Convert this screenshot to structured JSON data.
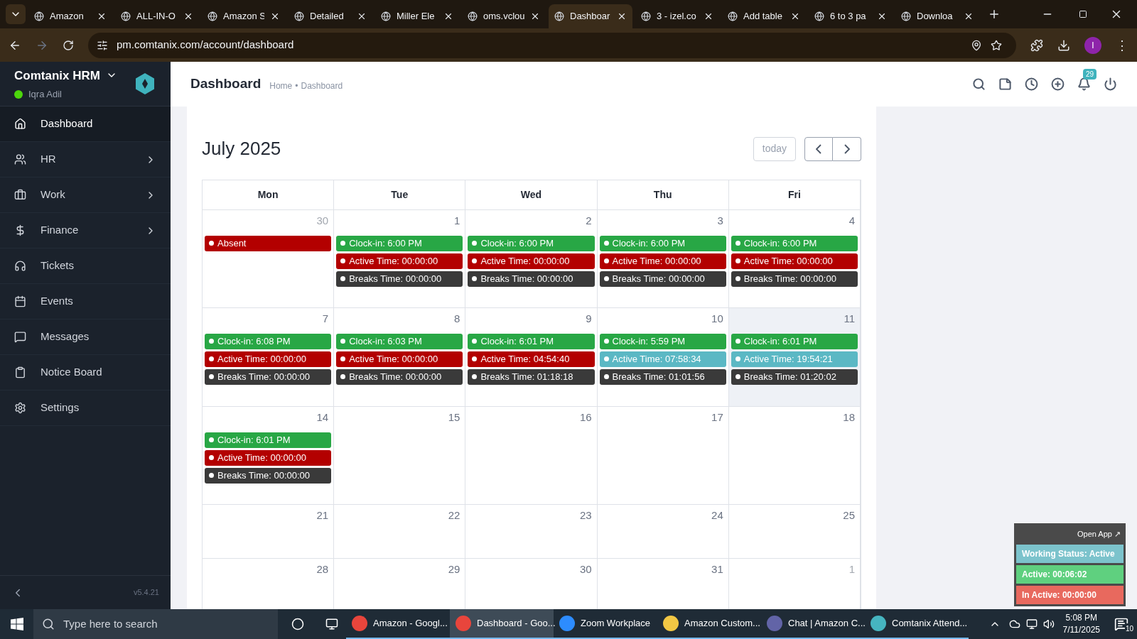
{
  "browser": {
    "tabs": [
      {
        "title": "Amazon",
        "selected": false
      },
      {
        "title": "ALL-IN-O",
        "selected": false
      },
      {
        "title": "Amazon S",
        "selected": false
      },
      {
        "title": "Detailed",
        "selected": false
      },
      {
        "title": "Miller Ele",
        "selected": false
      },
      {
        "title": "oms.vclou",
        "selected": false
      },
      {
        "title": "Dashboar",
        "selected": true
      },
      {
        "title": "3 - izel.co",
        "selected": false
      },
      {
        "title": "Add table",
        "selected": false
      },
      {
        "title": "6 to 3 pa",
        "selected": false
      },
      {
        "title": "Downloa",
        "selected": false
      }
    ],
    "url": "pm.comtanix.com/account/dashboard",
    "profile": "I",
    "menu": "⋮"
  },
  "sidebar": {
    "brand": "Comtanix HRM",
    "user": "Iqra Adil",
    "online": true,
    "items": [
      {
        "label": "Dashboard",
        "selected": true,
        "has_submenu": false
      },
      {
        "label": "HR",
        "selected": false,
        "has_submenu": true
      },
      {
        "label": "Work",
        "selected": false,
        "has_submenu": true
      },
      {
        "label": "Finance",
        "selected": false,
        "has_submenu": true
      },
      {
        "label": "Tickets",
        "selected": false,
        "has_submenu": false
      },
      {
        "label": "Events",
        "selected": false,
        "has_submenu": false
      },
      {
        "label": "Messages",
        "selected": false,
        "has_submenu": false
      },
      {
        "label": "Notice Board",
        "selected": false,
        "has_submenu": false
      },
      {
        "label": "Settings",
        "selected": false,
        "has_submenu": false
      }
    ],
    "version": "v5.4.21"
  },
  "header": {
    "title": "Dashboard",
    "breadcrumb": [
      "Home",
      "Dashboard"
    ],
    "breadcrumb_separator": "•",
    "notification_count": "29"
  },
  "calendar": {
    "title": "July 2025",
    "today_button": "today",
    "days": [
      "Mon",
      "Tue",
      "Wed",
      "Thu",
      "Fri"
    ],
    "weeks": [
      [
        {
          "date": "30",
          "other_month": true,
          "today": false,
          "events": [
            {
              "text": "Absent",
              "color": "#b30000"
            }
          ]
        },
        {
          "date": "1",
          "other_month": false,
          "today": false,
          "events": [
            {
              "text": "Clock-in: 6:00 PM",
              "color": "#28a745"
            },
            {
              "text": "Active Time: 00:00:00",
              "color": "#b30000"
            },
            {
              "text": "Breaks Time: 00:00:00",
              "color": "#3a3a3a"
            }
          ]
        },
        {
          "date": "2",
          "other_month": false,
          "today": false,
          "events": [
            {
              "text": "Clock-in: 6:00 PM",
              "color": "#28a745"
            },
            {
              "text": "Active Time: 00:00:00",
              "color": "#b30000"
            },
            {
              "text": "Breaks Time: 00:00:00",
              "color": "#3a3a3a"
            }
          ]
        },
        {
          "date": "3",
          "other_month": false,
          "today": false,
          "events": [
            {
              "text": "Clock-in: 6:00 PM",
              "color": "#28a745"
            },
            {
              "text": "Active Time: 00:00:00",
              "color": "#b30000"
            },
            {
              "text": "Breaks Time: 00:00:00",
              "color": "#3a3a3a"
            }
          ]
        },
        {
          "date": "4",
          "other_month": false,
          "today": false,
          "events": [
            {
              "text": "Clock-in: 6:00 PM",
              "color": "#28a745"
            },
            {
              "text": "Active Time: 00:00:00",
              "color": "#b30000"
            },
            {
              "text": "Breaks Time: 00:00:00",
              "color": "#3a3a3a"
            }
          ]
        }
      ],
      [
        {
          "date": "7",
          "other_month": false,
          "today": false,
          "events": [
            {
              "text": "Clock-in: 6:08 PM",
              "color": "#28a745"
            },
            {
              "text": "Active Time: 00:00:00",
              "color": "#b30000"
            },
            {
              "text": "Breaks Time: 00:00:00",
              "color": "#3a3a3a"
            }
          ]
        },
        {
          "date": "8",
          "other_month": false,
          "today": false,
          "events": [
            {
              "text": "Clock-in: 6:03 PM",
              "color": "#28a745"
            },
            {
              "text": "Active Time: 00:00:00",
              "color": "#b30000"
            },
            {
              "text": "Breaks Time: 00:00:00",
              "color": "#3a3a3a"
            }
          ]
        },
        {
          "date": "9",
          "other_month": false,
          "today": false,
          "events": [
            {
              "text": "Clock-in: 6:01 PM",
              "color": "#28a745"
            },
            {
              "text": "Active Time: 04:54:40",
              "color": "#b30000"
            },
            {
              "text": "Breaks Time: 01:18:18",
              "color": "#3a3a3a"
            }
          ]
        },
        {
          "date": "10",
          "other_month": false,
          "today": false,
          "events": [
            {
              "text": "Clock-in: 5:59 PM",
              "color": "#28a745"
            },
            {
              "text": "Active Time: 07:58:34",
              "color": "#5bb8c4"
            },
            {
              "text": "Breaks Time: 01:01:56",
              "color": "#3a3a3a"
            }
          ]
        },
        {
          "date": "11",
          "other_month": false,
          "today": true,
          "events": [
            {
              "text": "Clock-in: 6:01 PM",
              "color": "#28a745"
            },
            {
              "text": "Active Time: 19:54:21",
              "color": "#5bb8c4"
            },
            {
              "text": "Breaks Time: 01:20:02",
              "color": "#3a3a3a"
            }
          ]
        }
      ],
      [
        {
          "date": "14",
          "other_month": false,
          "today": false,
          "events": [
            {
              "text": "Clock-in: 6:01 PM",
              "color": "#28a745"
            },
            {
              "text": "Active Time: 00:00:00",
              "color": "#b30000"
            },
            {
              "text": "Breaks Time: 00:00:00",
              "color": "#3a3a3a"
            }
          ]
        },
        {
          "date": "15",
          "other_month": false,
          "today": false
        },
        {
          "date": "16",
          "other_month": false,
          "today": false
        },
        {
          "date": "17",
          "other_month": false,
          "today": false
        },
        {
          "date": "18",
          "other_month": false,
          "today": false
        }
      ],
      [
        {
          "date": "21",
          "other_month": false,
          "today": false
        },
        {
          "date": "22",
          "other_month": false,
          "today": false
        },
        {
          "date": "23",
          "other_month": false,
          "today": false
        },
        {
          "date": "24",
          "other_month": false,
          "today": false
        },
        {
          "date": "25",
          "other_month": false,
          "today": false
        }
      ],
      [
        {
          "date": "28",
          "other_month": false,
          "today": false
        },
        {
          "date": "29",
          "other_month": false,
          "today": false
        },
        {
          "date": "30",
          "other_month": false,
          "today": false
        },
        {
          "date": "31",
          "other_month": false,
          "today": false
        },
        {
          "date": "1",
          "other_month": true,
          "today": false
        }
      ]
    ]
  },
  "tracker": {
    "open_app": "Open App ↗",
    "rows": [
      {
        "text": "Working Status: Active",
        "color": "#7cc3cc"
      },
      {
        "text": "Active: 00:06:02",
        "color": "#5fd07f"
      },
      {
        "text": "In Active: 00:00:00",
        "color": "#e8695e"
      }
    ]
  },
  "taskbar": {
    "search_placeholder": "Type here to search",
    "apps": [
      {
        "title": "Amazon - Googl...",
        "selected": false
      },
      {
        "title": "Dashboard - Goo...",
        "selected": true
      },
      {
        "title": "Zoom Workplace",
        "selected": false
      },
      {
        "title": "Amazon Custom...",
        "selected": false
      },
      {
        "title": "Chat | Amazon C...",
        "selected": false
      },
      {
        "title": "Comtanix Attend...",
        "selected": false
      }
    ],
    "time": "5:08 PM",
    "date": "7/11/2025",
    "notifications": "10"
  }
}
